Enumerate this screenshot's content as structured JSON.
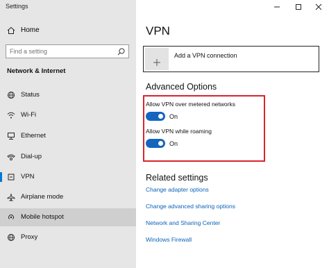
{
  "window": {
    "title": "Settings",
    "controls": [
      "minimize-icon",
      "maximize-icon",
      "close-icon"
    ]
  },
  "sidebar": {
    "home_label": "Home",
    "search": {
      "placeholder": "Find a setting"
    },
    "section_heading": "Network & Internet",
    "items": [
      {
        "label": "Status",
        "icon": "status-globe-icon"
      },
      {
        "label": "Wi-Fi",
        "icon": "wifi-icon"
      },
      {
        "label": "Ethernet",
        "icon": "ethernet-icon"
      },
      {
        "label": "Dial-up",
        "icon": "dial-up-icon"
      },
      {
        "label": "VPN",
        "icon": "vpn-icon",
        "selected": true
      },
      {
        "label": "Airplane mode",
        "icon": "airplane-icon"
      },
      {
        "label": "Mobile hotspot",
        "icon": "hotspot-icon",
        "hovered": true
      },
      {
        "label": "Proxy",
        "icon": "proxy-globe-icon"
      }
    ]
  },
  "main": {
    "title": "VPN",
    "add_vpn_label": "Add a VPN connection",
    "advanced_heading": "Advanced Options",
    "options": [
      {
        "label": "Allow VPN over metered networks",
        "state": "On"
      },
      {
        "label": "Allow VPN while roaming",
        "state": "On"
      }
    ],
    "related_heading": "Related settings",
    "related_links": [
      "Change adapter options",
      "Change advanced sharing options",
      "Network and Sharing Center",
      "Windows Firewall"
    ]
  },
  "colors": {
    "accent": "#0078d7",
    "toggle_on": "#1565c0",
    "link": "#0b63b8",
    "highlight_border": "#d9232d",
    "sidebar_bg": "#e6e6e6"
  }
}
